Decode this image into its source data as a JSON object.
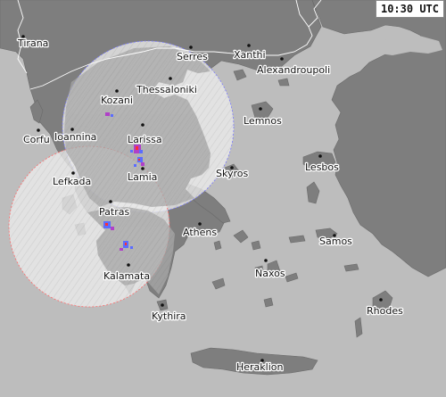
{
  "timestamp": "10:30 UTC",
  "colors": {
    "sea": "#bdbdbd",
    "land": "#7e7e7e",
    "radar_coverage": "#e6e6e6",
    "border": "#ffffff",
    "precip_light": "#5b6cff",
    "precip_medium": "#b040c8",
    "precip_heavy": "#ff3030"
  },
  "cities": [
    {
      "id": "tirana",
      "name": "Tirana"
    },
    {
      "id": "serres",
      "name": "Serres"
    },
    {
      "id": "xanthi",
      "name": "Xanthi"
    },
    {
      "id": "alexandroupoli",
      "name": "Alexandroupoli"
    },
    {
      "id": "kozani",
      "name": "Kozani"
    },
    {
      "id": "thessaloniki",
      "name": "Thessaloniki"
    },
    {
      "id": "lemnos",
      "name": "Lemnos"
    },
    {
      "id": "corfu",
      "name": "Corfu"
    },
    {
      "id": "ioannina",
      "name": "Ioannina"
    },
    {
      "id": "larissa",
      "name": "Larissa"
    },
    {
      "id": "lesbos",
      "name": "Lesbos"
    },
    {
      "id": "lamia",
      "name": "Lamia"
    },
    {
      "id": "skyros",
      "name": "Skyros"
    },
    {
      "id": "lefkada",
      "name": "Lefkada"
    },
    {
      "id": "patras",
      "name": "Patras"
    },
    {
      "id": "athens",
      "name": "Athens"
    },
    {
      "id": "samos",
      "name": "Samos"
    },
    {
      "id": "naxos",
      "name": "Naxos"
    },
    {
      "id": "kalamata",
      "name": "Kalamata"
    },
    {
      "id": "rhodes",
      "name": "Rhodes"
    },
    {
      "id": "kythira",
      "name": "Kythira"
    },
    {
      "id": "heraklion",
      "name": "Heraklion"
    }
  ]
}
